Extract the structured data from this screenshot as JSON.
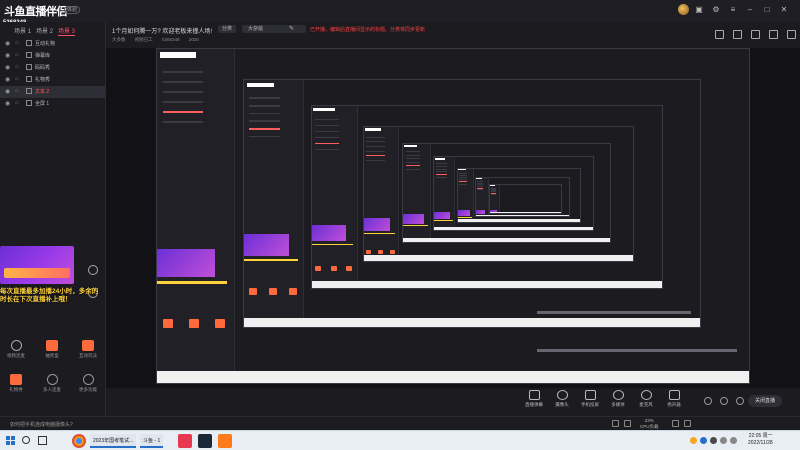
{
  "app": {
    "logo": "斗鱼直播伴侣",
    "logo_badge": "体验",
    "room_id": "5368348"
  },
  "sidebar": {
    "scene_tabs": [
      "场景 1",
      "场景 2",
      "场景 3"
    ],
    "active_scene": 2,
    "layers": [
      {
        "name": "互动礼物"
      },
      {
        "name": "弹幕库"
      },
      {
        "name": "码码秀"
      },
      {
        "name": "礼物秀"
      },
      {
        "name": "文本 2",
        "selected": true
      },
      {
        "name": "全屏 1"
      }
    ],
    "promo_text": "每次直播最多加播24小时，多余的时长在下次直播补上哦！",
    "tools": [
      {
        "label": "视频连麦",
        "icon": "video-connect-icon"
      },
      {
        "label": "抽奖盒",
        "icon": "lottery-icon"
      },
      {
        "label": "互动玩法",
        "icon": "interactive-icon"
      },
      {
        "label": "礼物秀",
        "icon": "gift-show-icon"
      },
      {
        "label": "多人连麦",
        "icon": "multi-connect-icon"
      },
      {
        "label": "更多功能",
        "icon": "more-icon"
      }
    ]
  },
  "header": {
    "stream_title": "1个月如何腾一万?  欢迎老板来撞人场!",
    "tag_btn": "分类",
    "category": "大杂烩",
    "warning": "已开播，编辑后直播间显示的标题、分类将同步更新",
    "sub_items": [
      "大多数",
      "视频已工",
      "5368348",
      "2020"
    ]
  },
  "controls": {
    "items": [
      {
        "label": "直播弹幕",
        "icon": "danmu-icon"
      },
      {
        "label": "摄像头",
        "icon": "camera-icon"
      },
      {
        "label": "手机投屏",
        "icon": "phone-cast-icon"
      },
      {
        "label": "多媒体",
        "icon": "media-icon"
      },
      {
        "label": "麦克风",
        "icon": "microphone-icon"
      },
      {
        "label": "扬声器",
        "icon": "speaker-icon"
      }
    ],
    "live_button": "关闭直播"
  },
  "status": {
    "hint": "如何把手机连成电脑摄像头?",
    "cpu_percent": "23%",
    "cpu_label": "CPU负载"
  },
  "taskbar": {
    "tasks": [
      "2023年国考笔试...",
      "斗鱼 - 1"
    ],
    "time": "22:05 周一",
    "date": "2022/11/28"
  }
}
